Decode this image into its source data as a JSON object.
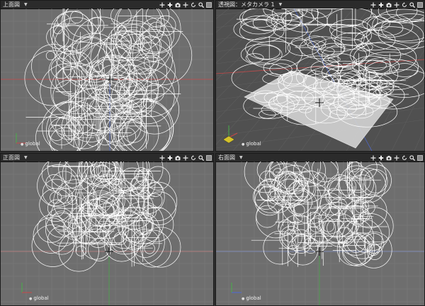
{
  "viewports": [
    {
      "id": "top",
      "title": "上面図",
      "menu": "▼",
      "global": "global",
      "type": "top"
    },
    {
      "id": "persp",
      "title": "透視図：メタカメラ 1",
      "menu": "▼",
      "global": "global",
      "type": "persp"
    },
    {
      "id": "front",
      "title": "正面図",
      "menu": "▼",
      "global": "global",
      "type": "front"
    },
    {
      "id": "side",
      "title": "右面図",
      "menu": "▼",
      "global": "global",
      "type": "side"
    }
  ],
  "colors": {
    "bg": "#6e6e6e",
    "persp_bg": "#505050",
    "grid": "#7d7d7d",
    "grid_dark": "#5e5e5e",
    "wire": "#ffffff",
    "axis_x": "#c84848",
    "axis_y": "#48b048",
    "axis_z": "#4d6ad8",
    "plane": "#d4d4d4"
  },
  "toolbar_icons": [
    "move-icon",
    "zoom-plus-icon",
    "camera-icon",
    "move-icon",
    "rotate-icon",
    "zoom-icon",
    "maximize-icon"
  ]
}
